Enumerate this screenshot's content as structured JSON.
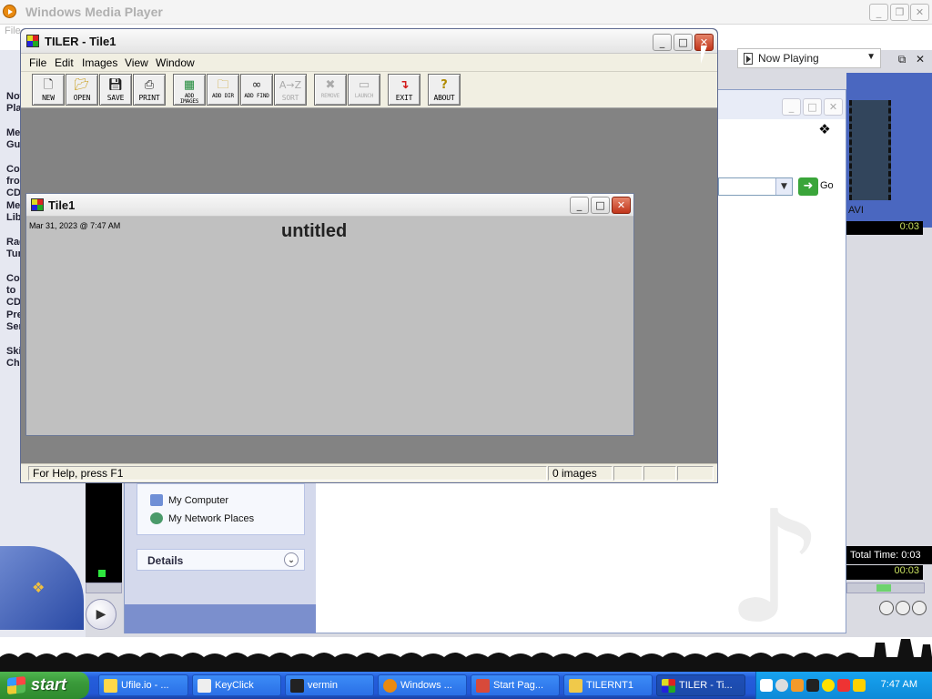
{
  "wmp": {
    "title": "Windows Media Player",
    "menu_hint": "File",
    "left_nav": [
      "Now Playing",
      "Media Guide",
      "Copy from CD",
      "Media Library",
      "Radio Tuner",
      "Copy to CD or Device",
      "Premium Services",
      "Skin Chooser"
    ],
    "now_playing_label": "Now Playing",
    "clip_label": "AVI",
    "time_top": "0:03",
    "total_time": "Total Time: 0:03",
    "elapsed": "00:03"
  },
  "explorer": {
    "go_label": "Go",
    "places": [
      "My Computer",
      "My Network Places"
    ],
    "details_label": "Details"
  },
  "tiler": {
    "title": "TILER - Tile1",
    "menu": [
      "File",
      "Edit",
      "Images",
      "View",
      "Window"
    ],
    "toolbar": [
      {
        "label": "NEW",
        "icon": "new-document-icon",
        "enabled": true
      },
      {
        "label": "OPEN",
        "icon": "open-folder-icon",
        "enabled": true
      },
      {
        "label": "SAVE",
        "icon": "floppy-disk-icon",
        "enabled": true
      },
      {
        "label": "PRINT",
        "icon": "printer-icon",
        "enabled": true
      },
      {
        "label": "ADD IMAGES",
        "icon": "add-images-icon",
        "enabled": true
      },
      {
        "label": "ADD DIR",
        "icon": "add-dir-icon",
        "enabled": true
      },
      {
        "label": "ADD FIND",
        "icon": "binoculars-icon",
        "enabled": true
      },
      {
        "label": "SORT",
        "icon": "sort-az-icon",
        "enabled": false
      },
      {
        "label": "REMOVE",
        "icon": "remove-x-icon",
        "enabled": false
      },
      {
        "label": "LAUNCH",
        "icon": "launch-icon",
        "enabled": false
      },
      {
        "label": "EXIT",
        "icon": "exit-arrow-icon",
        "enabled": true
      },
      {
        "label": "ABOUT",
        "icon": "question-icon",
        "enabled": true
      }
    ],
    "sort_glyph": "A→Z",
    "status_help": "For Help, press F1",
    "status_count": "0 images",
    "child": {
      "title": "Tile1",
      "date": "Mar 31, 2023 @ 7:47 AM",
      "doc_title": "untitled"
    }
  },
  "taskbar": {
    "start_label": "start",
    "items": [
      "Ufile.io - ...",
      "KeyClick",
      "vermin",
      "Windows ...",
      "Start Pag...",
      "TILERNT1",
      "TILER - Ti..."
    ],
    "active_index": 6,
    "clock": "7:47 AM"
  }
}
